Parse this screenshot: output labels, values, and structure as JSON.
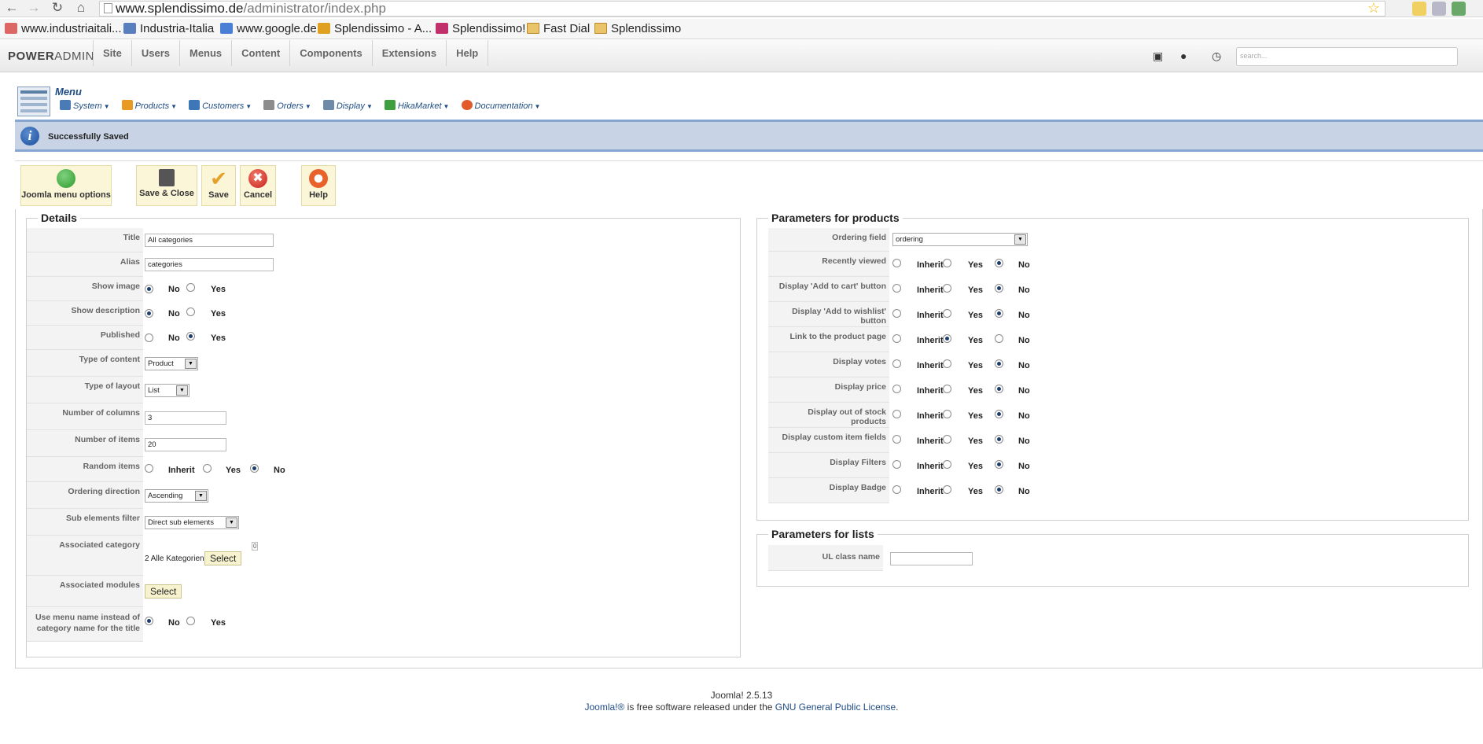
{
  "browser": {
    "url_host": "www.splendissimo.de",
    "url_path": "/administrator/index.php",
    "bookmarks": [
      {
        "label": "www.industriaitali...",
        "color": "#d66"
      },
      {
        "label": "Industria-Italia",
        "color": "#5a7fbf"
      },
      {
        "label": "www.google.de",
        "color": "#4a7fd8"
      },
      {
        "label": "Splendissimo - A...",
        "color": "#e0a020"
      },
      {
        "label": "Splendissimo!",
        "color": "#c0306a"
      },
      {
        "label": "Fast Dial",
        "color": "#e9c46a"
      },
      {
        "label": "Splendissimo",
        "color": "#e9c46a"
      }
    ]
  },
  "adminbar": {
    "logo_bold": "POWER",
    "logo_thin": "ADMIN",
    "menu": [
      "Site",
      "Users",
      "Menus",
      "Content",
      "Components",
      "Extensions",
      "Help"
    ],
    "search_placeholder": "search..."
  },
  "submenu": {
    "title": "Menu",
    "items": [
      {
        "label": "System",
        "color": "#4a7bb7"
      },
      {
        "label": "Products",
        "color": "#e89a22"
      },
      {
        "label": "Customers",
        "color": "#3d77b8"
      },
      {
        "label": "Orders",
        "color": "#8c8c8c"
      },
      {
        "label": "Display",
        "color": "#6e8aa8"
      },
      {
        "label": "HikaMarket",
        "color": "#3f9f3f"
      },
      {
        "label": "Documentation",
        "color": "#e05a2a"
      }
    ]
  },
  "message": {
    "text": "Successfully Saved"
  },
  "toolbar": {
    "joomla_menu_options": "Joomla menu options",
    "save_close": "Save & Close",
    "save": "Save",
    "cancel": "Cancel",
    "help": "Help"
  },
  "details": {
    "legend": "Details",
    "title_label": "Title",
    "title_value": "All categories",
    "alias_label": "Alias",
    "alias_value": "categories",
    "show_image_label": "Show image",
    "show_image_selected": "No",
    "show_description_label": "Show description",
    "show_description_selected": "No",
    "published_label": "Published",
    "published_selected": "Yes",
    "type_content_label": "Type of content",
    "type_content_value": "Product",
    "type_layout_label": "Type of layout",
    "type_layout_value": "List",
    "num_columns_label": "Number of columns",
    "num_columns_value": "3",
    "num_items_label": "Number of items",
    "num_items_value": "20",
    "random_items_label": "Random items",
    "random_items_selected": "No",
    "ordering_direction_label": "Ordering direction",
    "ordering_direction_value": "Ascending",
    "sub_elements_label": "Sub elements filter",
    "sub_elements_value": "Direct sub elements",
    "assoc_category_label": "Associated category",
    "assoc_category_value": "2 Alle Kategorien",
    "assoc_category_count": "0",
    "assoc_modules_label": "Associated modules",
    "select_label": "Select",
    "use_menu_name_label": "Use menu name instead of category name for the title",
    "use_menu_name_selected": "No",
    "opt_no": "No",
    "opt_yes": "Yes",
    "opt_inherit": "Inherit"
  },
  "products": {
    "legend": "Parameters for products",
    "ordering_field_label": "Ordering field",
    "ordering_field_value": "ordering",
    "params": [
      {
        "label": "Recently viewed",
        "selected": "No"
      },
      {
        "label": "Display 'Add to cart' button",
        "selected": "No"
      },
      {
        "label": "Display 'Add to wishlist' button",
        "selected": "No"
      },
      {
        "label": "Link to the product page",
        "selected": "Yes"
      },
      {
        "label": "Display votes",
        "selected": "No"
      },
      {
        "label": "Display price",
        "selected": "No"
      },
      {
        "label": "Display out of stock products",
        "selected": "No"
      },
      {
        "label": "Display custom item fields",
        "selected": "No"
      },
      {
        "label": "Display Filters",
        "selected": "No"
      },
      {
        "label": "Display Badge",
        "selected": "No"
      }
    ]
  },
  "lists": {
    "legend": "Parameters for lists",
    "ul_class_label": "UL class name",
    "ul_class_value": ""
  },
  "footer": {
    "version": "Joomla! 2.5.13",
    "joomla_link": "Joomla!®",
    "middle": " is free software released under the ",
    "license_link": "GNU General Public License",
    "end": "."
  }
}
